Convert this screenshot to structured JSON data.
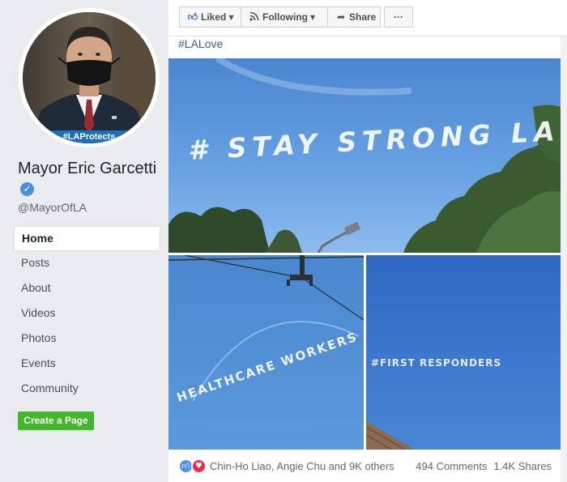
{
  "profile": {
    "name": "Mayor Eric Garcetti",
    "handle": "@MayorOfLA",
    "avatar_banner": "#LAProtects",
    "verified_icon": "verified-check-icon"
  },
  "nav": {
    "items": [
      {
        "label": "Home",
        "active": true
      },
      {
        "label": "Posts"
      },
      {
        "label": "About"
      },
      {
        "label": "Videos"
      },
      {
        "label": "Photos"
      },
      {
        "label": "Events"
      },
      {
        "label": "Community"
      }
    ]
  },
  "create_page_label": "Create a Page",
  "actions": {
    "liked": "Liked",
    "following": "Following",
    "share": "Share",
    "more": "···"
  },
  "post": {
    "hashtag": "#LALove",
    "photos": [
      {
        "skywriting": "# STAY STRONG LA"
      },
      {
        "skywriting": "HEALTHCARE WORKERS"
      },
      {
        "skywriting": "#FIRST RESPONDERS"
      }
    ],
    "reactions_text": "Chin-Ho Liao, Angie Chu and 9K others",
    "comments": "494 Comments",
    "shares": "1.4K Shares"
  },
  "colors": {
    "background": "#e9ebee",
    "link": "#385898",
    "create_button": "#42b72a",
    "like": "#4f8ff5",
    "love": "#f0284a"
  }
}
